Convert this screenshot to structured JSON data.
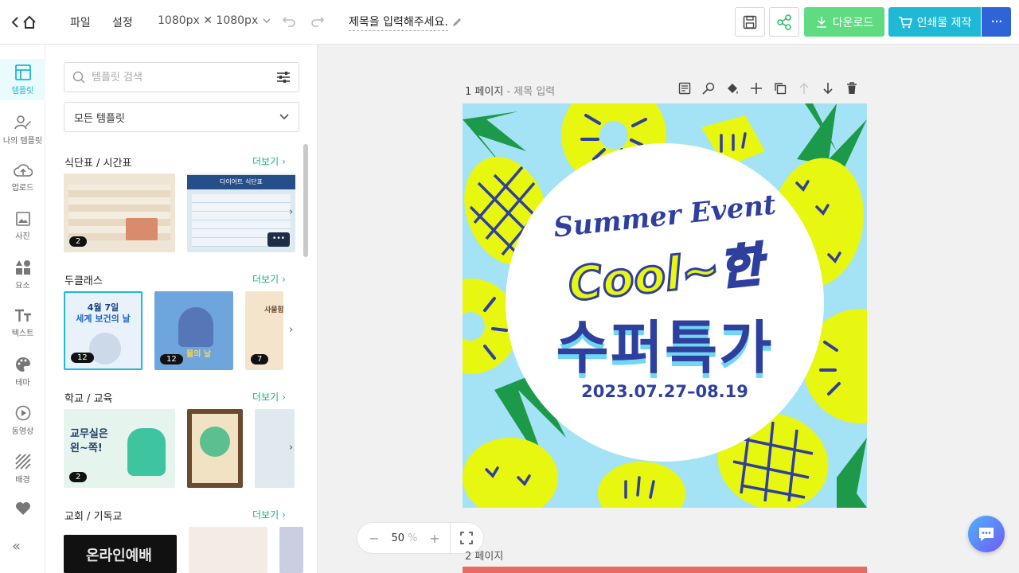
{
  "topbar": {
    "menu_file": "파일",
    "menu_settings": "설정",
    "canvas_size": "1080px ✕ 1080px",
    "title": "제목을 입력해주세요.",
    "download_label": "다운로드",
    "print_label": "인쇄물 제작",
    "more_label": "···"
  },
  "rail": {
    "items": [
      {
        "label": "템플릿",
        "icon": "template-icon"
      },
      {
        "label": "나의 템플릿",
        "icon": "my-template-icon"
      },
      {
        "label": "업로드",
        "icon": "upload-icon"
      },
      {
        "label": "사진",
        "icon": "photo-icon"
      },
      {
        "label": "요소",
        "icon": "elements-icon"
      },
      {
        "label": "텍스트",
        "icon": "text-icon"
      },
      {
        "label": "테마",
        "icon": "theme-icon"
      },
      {
        "label": "동영상",
        "icon": "video-icon"
      },
      {
        "label": "배경",
        "icon": "background-icon"
      },
      {
        "label": "찜",
        "icon": "heart-icon"
      }
    ],
    "collapse": "«"
  },
  "panel": {
    "search_placeholder": "템플릿 검색",
    "filter_selected": "모든 템플릿",
    "more_label": "더보기",
    "sections": [
      {
        "title": "식단표 / 시간표",
        "badge": "2"
      },
      {
        "title": "두클래스",
        "badges": [
          "12",
          "12",
          "7"
        ]
      },
      {
        "title": "학교 / 교육",
        "badge": "2"
      },
      {
        "title": "교회 / 기독교"
      }
    ],
    "thumb_texts": {
      "diet": "다이어트 식단표",
      "health_day_1": "4월 7일",
      "health_day_2": "세계 보건의 날",
      "water_day": "물의 날",
      "partial": "사물함",
      "teacher_room_1": "교무실은",
      "teacher_room_2": "왼~쪽!",
      "worship": "온라인예배"
    }
  },
  "canvas": {
    "page1_number": "1 페이지",
    "page1_title": "- 제목 입력",
    "page2_number": "2 페이지",
    "zoom_value": "50",
    "zoom_unit": "%",
    "zoom_minus": "−",
    "zoom_plus": "+"
  },
  "artwork": {
    "line1": "Summer Event",
    "line2": "Cool~한",
    "line3": "수퍼특가",
    "date": "2023.07.27–08.19"
  },
  "colors": {
    "accent_green": "#5fdc82",
    "accent_cyan": "#1fb9d7",
    "accent_blue": "#2e64d8",
    "art_blue": "#2f3f9e",
    "art_yellow": "#e8f70f",
    "art_sky": "#a3e3f5"
  }
}
